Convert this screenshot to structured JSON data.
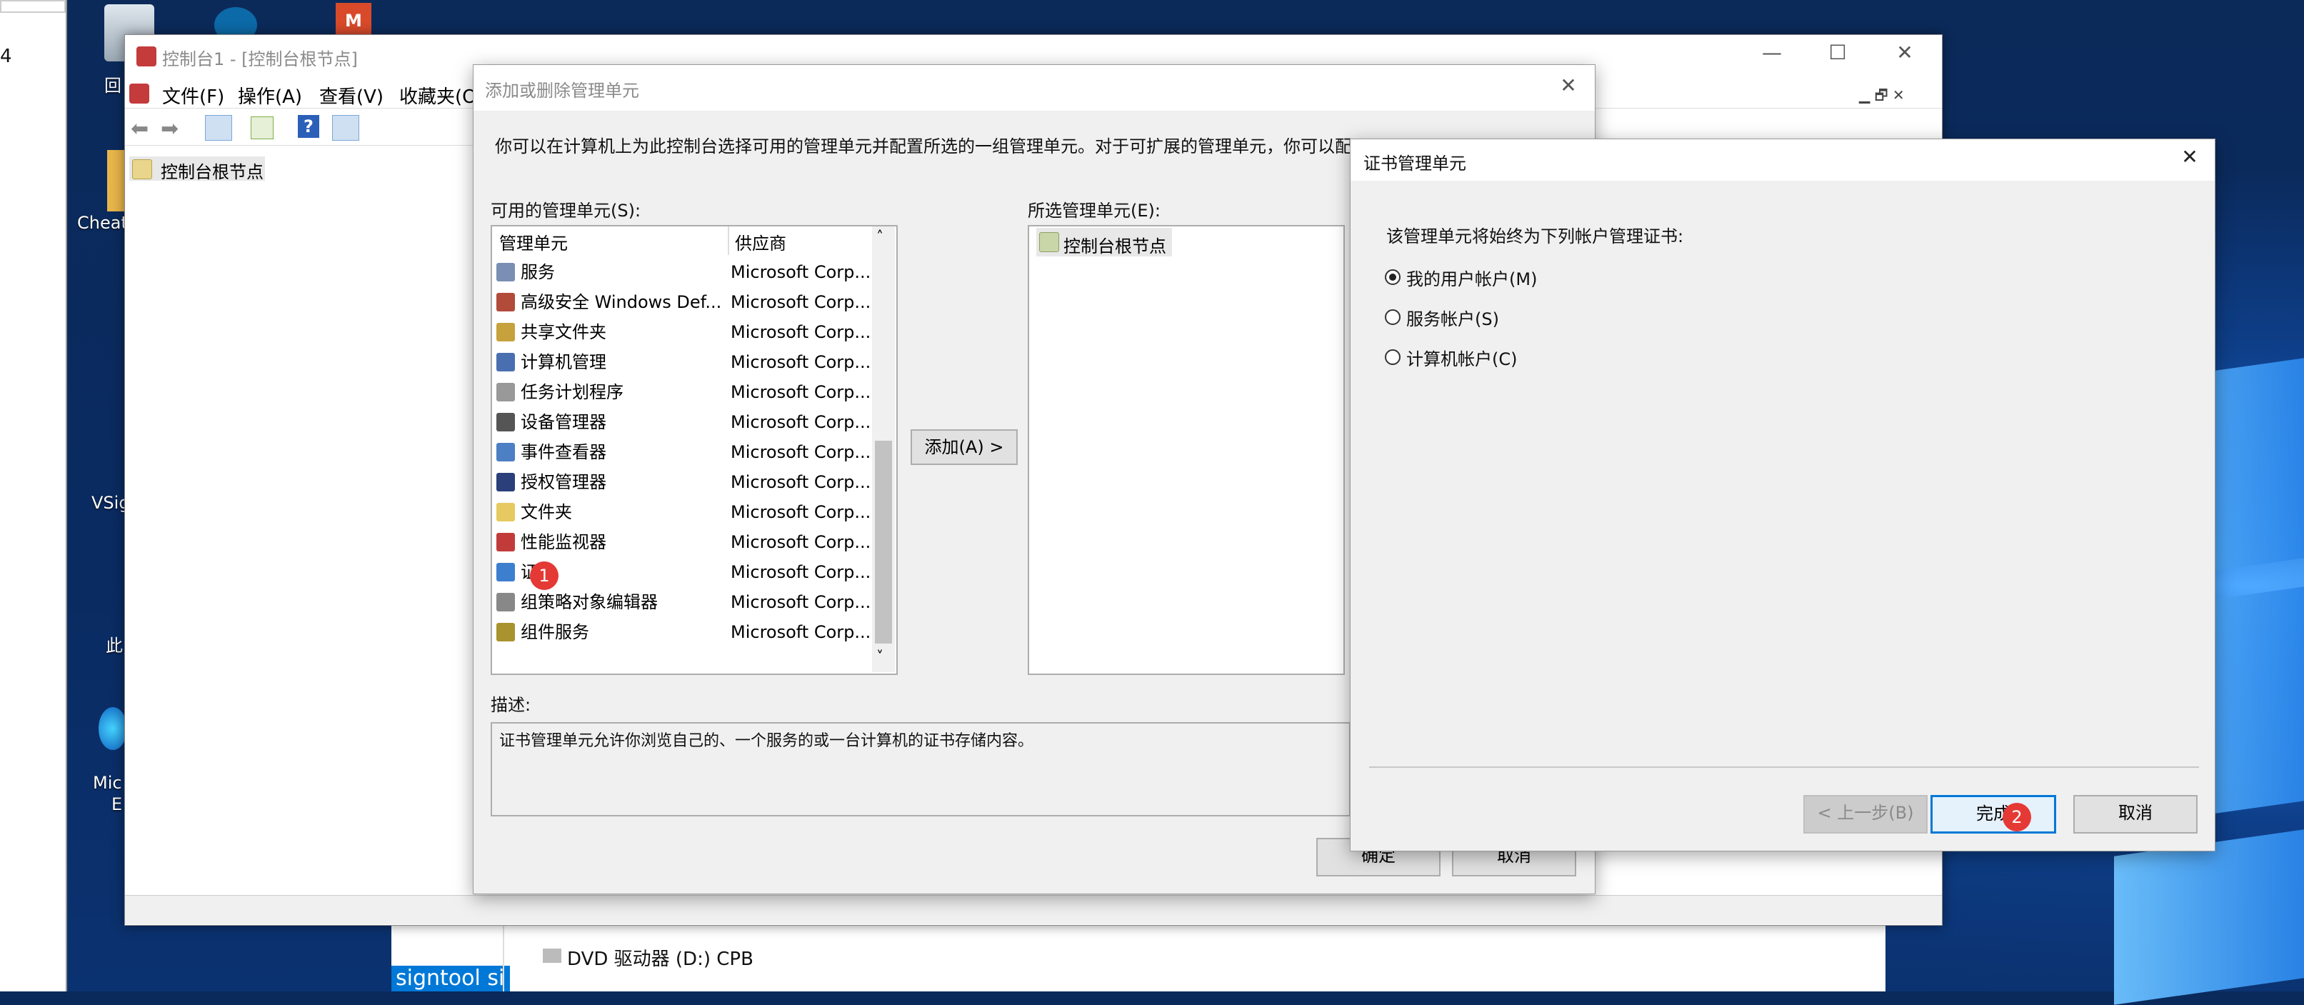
{
  "desktop": {
    "icons": [
      {
        "label": "回"
      },
      {
        "label": "Cheat"
      },
      {
        "label": "VSig"
      },
      {
        "label": "此"
      },
      {
        "label": "Mic"
      },
      {
        "label": "E"
      }
    ],
    "left_strip_text": "4",
    "bottom_text": "signtool si",
    "dvd_label": "DVD 驱动器 (D:) CPB"
  },
  "mmc": {
    "title": "控制台1 - [控制台根节点]",
    "menu": [
      "文件(F)",
      "操作(A)",
      "查看(V)",
      "收藏夹(O)"
    ],
    "tree_root": "控制台根节点",
    "controls": {
      "minimize": "—",
      "maximize": "☐",
      "close": "✕"
    }
  },
  "add_remove": {
    "title": "添加或删除管理单元",
    "intro": "你可以在计算机上为此控制台选择可用的管理单元并配置所选的一组管理单元。对于可扩展的管理单元，你可以配置要启用哪些扩展项。",
    "available_label": "可用的管理单元(S):",
    "columns": [
      "管理单元",
      "供应商"
    ],
    "snapins": [
      {
        "name": "服务",
        "vendor": "Microsoft Corp..."
      },
      {
        "name": "高级安全 Windows Def...",
        "vendor": "Microsoft Corp..."
      },
      {
        "name": "共享文件夹",
        "vendor": "Microsoft Corp..."
      },
      {
        "name": "计算机管理",
        "vendor": "Microsoft Corp..."
      },
      {
        "name": "任务计划程序",
        "vendor": "Microsoft Corp..."
      },
      {
        "name": "设备管理器",
        "vendor": "Microsoft Corp..."
      },
      {
        "name": "事件查看器",
        "vendor": "Microsoft Corp..."
      },
      {
        "name": "授权管理器",
        "vendor": "Microsoft Corp..."
      },
      {
        "name": "文件夹",
        "vendor": "Microsoft Corp..."
      },
      {
        "name": "性能监视器",
        "vendor": "Microsoft Corp..."
      },
      {
        "name": "证",
        "vendor": "Microsoft Corp..."
      },
      {
        "name": "组策略对象编辑器",
        "vendor": "Microsoft Corp..."
      },
      {
        "name": "组件服务",
        "vendor": "Microsoft Corp..."
      }
    ],
    "add_button": "添加(A) >",
    "selected_label": "所选管理单元(E):",
    "selected_items": [
      "控制台根节点"
    ],
    "description_label": "描述:",
    "description": "证书管理单元允许你浏览自己的、一个服务的或一台计算机的证书存储内容。",
    "ok": "确定",
    "cancel": "取消",
    "close": "✕"
  },
  "cert_dialog": {
    "title": "证书管理单元",
    "prompt": "该管理单元将始终为下列帐户管理证书:",
    "options": [
      {
        "label": "我的用户帐户(M)",
        "checked": true
      },
      {
        "label": "服务帐户(S)",
        "checked": false
      },
      {
        "label": "计算机帐户(C)",
        "checked": false
      }
    ],
    "back": "< 上一步(B)",
    "finish": "完成",
    "cancel": "取消",
    "close": "✕"
  },
  "annotations": {
    "step1": "1",
    "step2": "2"
  }
}
